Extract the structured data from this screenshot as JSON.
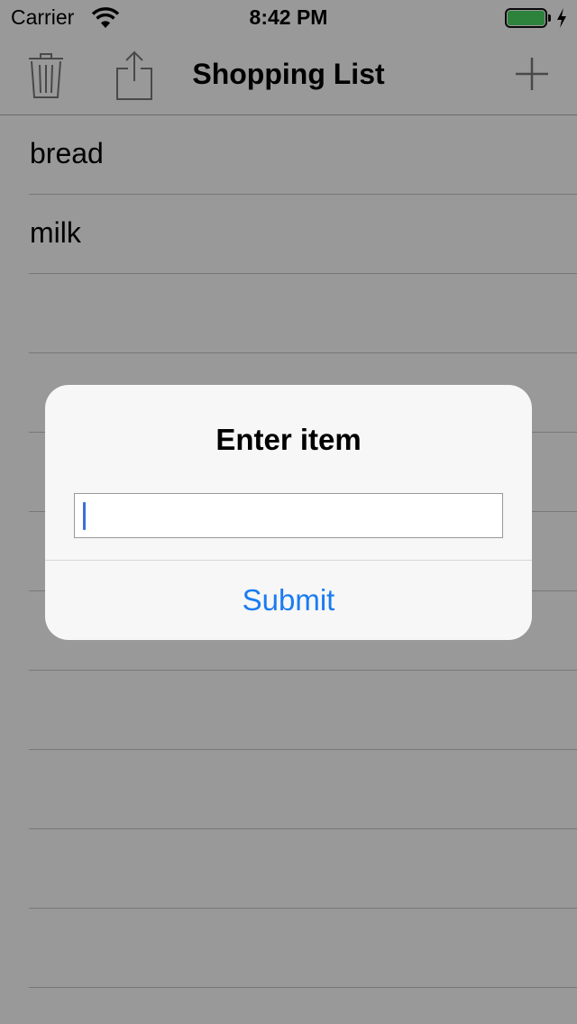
{
  "status_bar": {
    "carrier": "Carrier",
    "time": "8:42 PM",
    "battery_level": 1.0,
    "battery_color": "#4cd964",
    "charging": true
  },
  "nav_bar": {
    "title": "Shopping List",
    "left_icons": [
      "trash-icon",
      "share-icon"
    ],
    "right_icon": "plus-icon"
  },
  "list": {
    "items": [
      "bread",
      "milk",
      "",
      "",
      "",
      "",
      "",
      "",
      "",
      "",
      "",
      ""
    ]
  },
  "alert": {
    "title": "Enter item",
    "input_value": "",
    "input_placeholder": "",
    "button_label": "Submit",
    "accent_color": "#1a7cf1"
  }
}
